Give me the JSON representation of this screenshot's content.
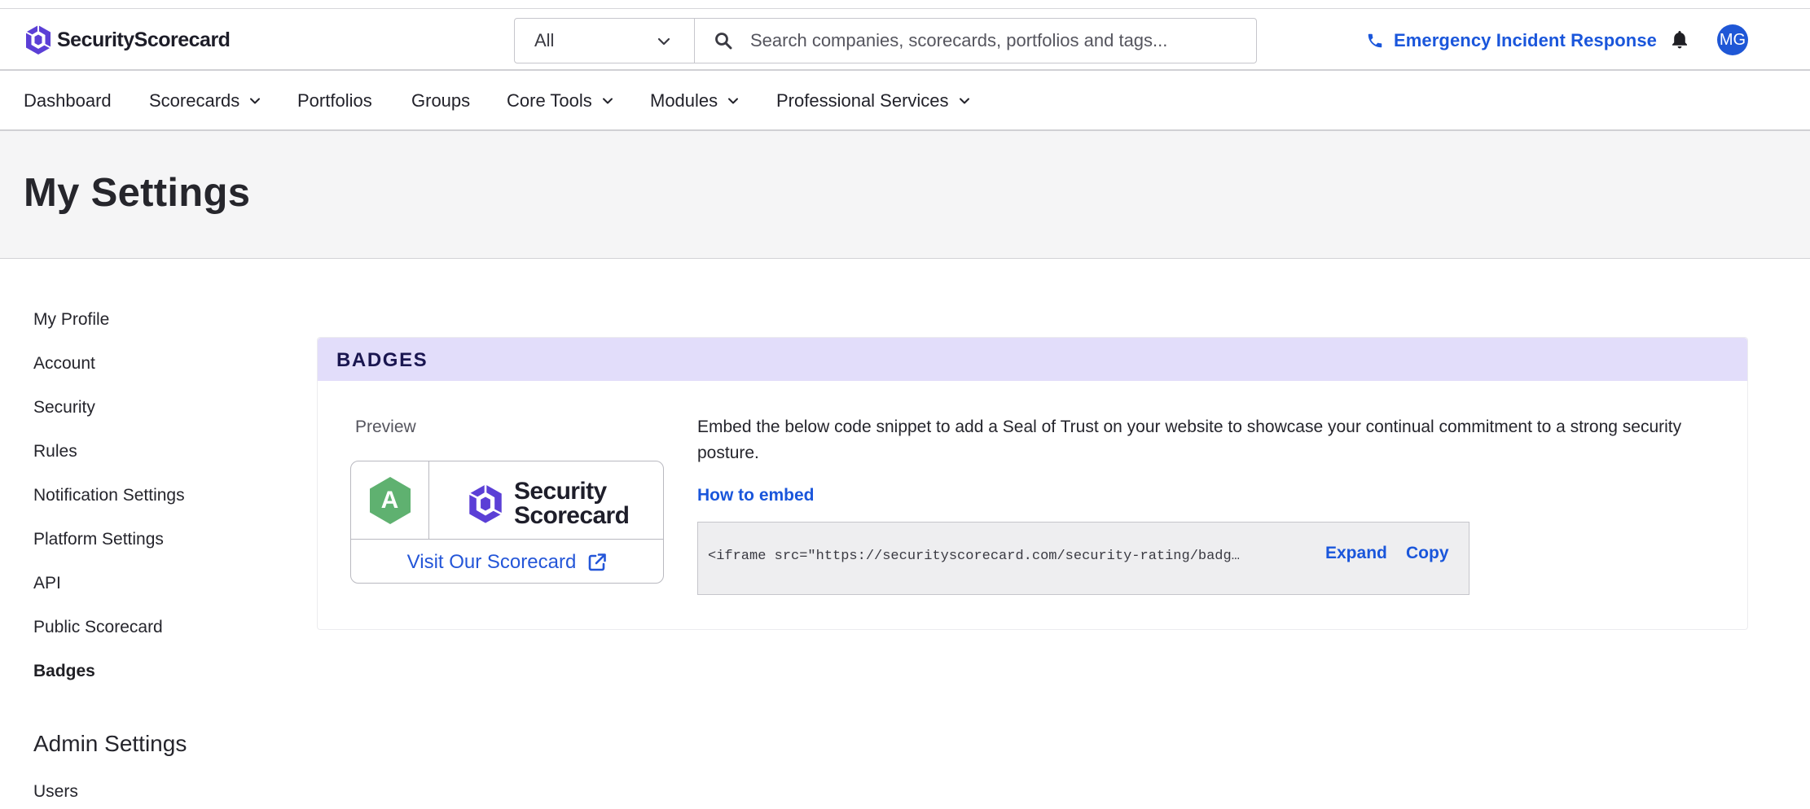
{
  "app": {
    "name": "SecurityScorecard",
    "brand_color": "#5b3fd6",
    "link_color": "#1a56db"
  },
  "header": {
    "scope_select": {
      "value": "All"
    },
    "search": {
      "placeholder": "Search companies, scorecards, portfolios and tags..."
    },
    "emergency_label": "Emergency Incident Response",
    "avatar_initials": "MG"
  },
  "nav": {
    "items": [
      {
        "label": "Dashboard",
        "dropdown": false
      },
      {
        "label": "Scorecards",
        "dropdown": true
      },
      {
        "label": "Portfolios",
        "dropdown": false
      },
      {
        "label": "Groups",
        "dropdown": false
      },
      {
        "label": "Core Tools",
        "dropdown": true
      },
      {
        "label": "Modules",
        "dropdown": true
      },
      {
        "label": "Professional Services",
        "dropdown": true
      }
    ]
  },
  "page": {
    "title": "My Settings"
  },
  "sidebar": {
    "items": [
      {
        "label": "My Profile",
        "active": false
      },
      {
        "label": "Account",
        "active": false
      },
      {
        "label": "Security",
        "active": false
      },
      {
        "label": "Rules",
        "active": false
      },
      {
        "label": "Notification Settings",
        "active": false
      },
      {
        "label": "Platform Settings",
        "active": false
      },
      {
        "label": "API",
        "active": false
      },
      {
        "label": "Public Scorecard",
        "active": false
      },
      {
        "label": "Badges",
        "active": true
      }
    ],
    "admin_section": {
      "title": "Admin Settings",
      "items": [
        {
          "label": "Users"
        }
      ]
    }
  },
  "badges": {
    "title": "BADGES",
    "preview_label": "Preview",
    "badge": {
      "grade": "A",
      "grade_color": "#5fb170",
      "logo_line1": "Security",
      "logo_line2": "Scorecard",
      "visit_label": "Visit Our Scorecard"
    },
    "description": "Embed the below code snippet to add a Seal of Trust on your website to showcase your continual commitment to a strong security posture.",
    "how_to_embed": "How to embed",
    "code_snippet": "<iframe src=\"https://securityscorecard.com/security-rating/badg…",
    "expand_label": "Expand",
    "copy_label": "Copy"
  }
}
